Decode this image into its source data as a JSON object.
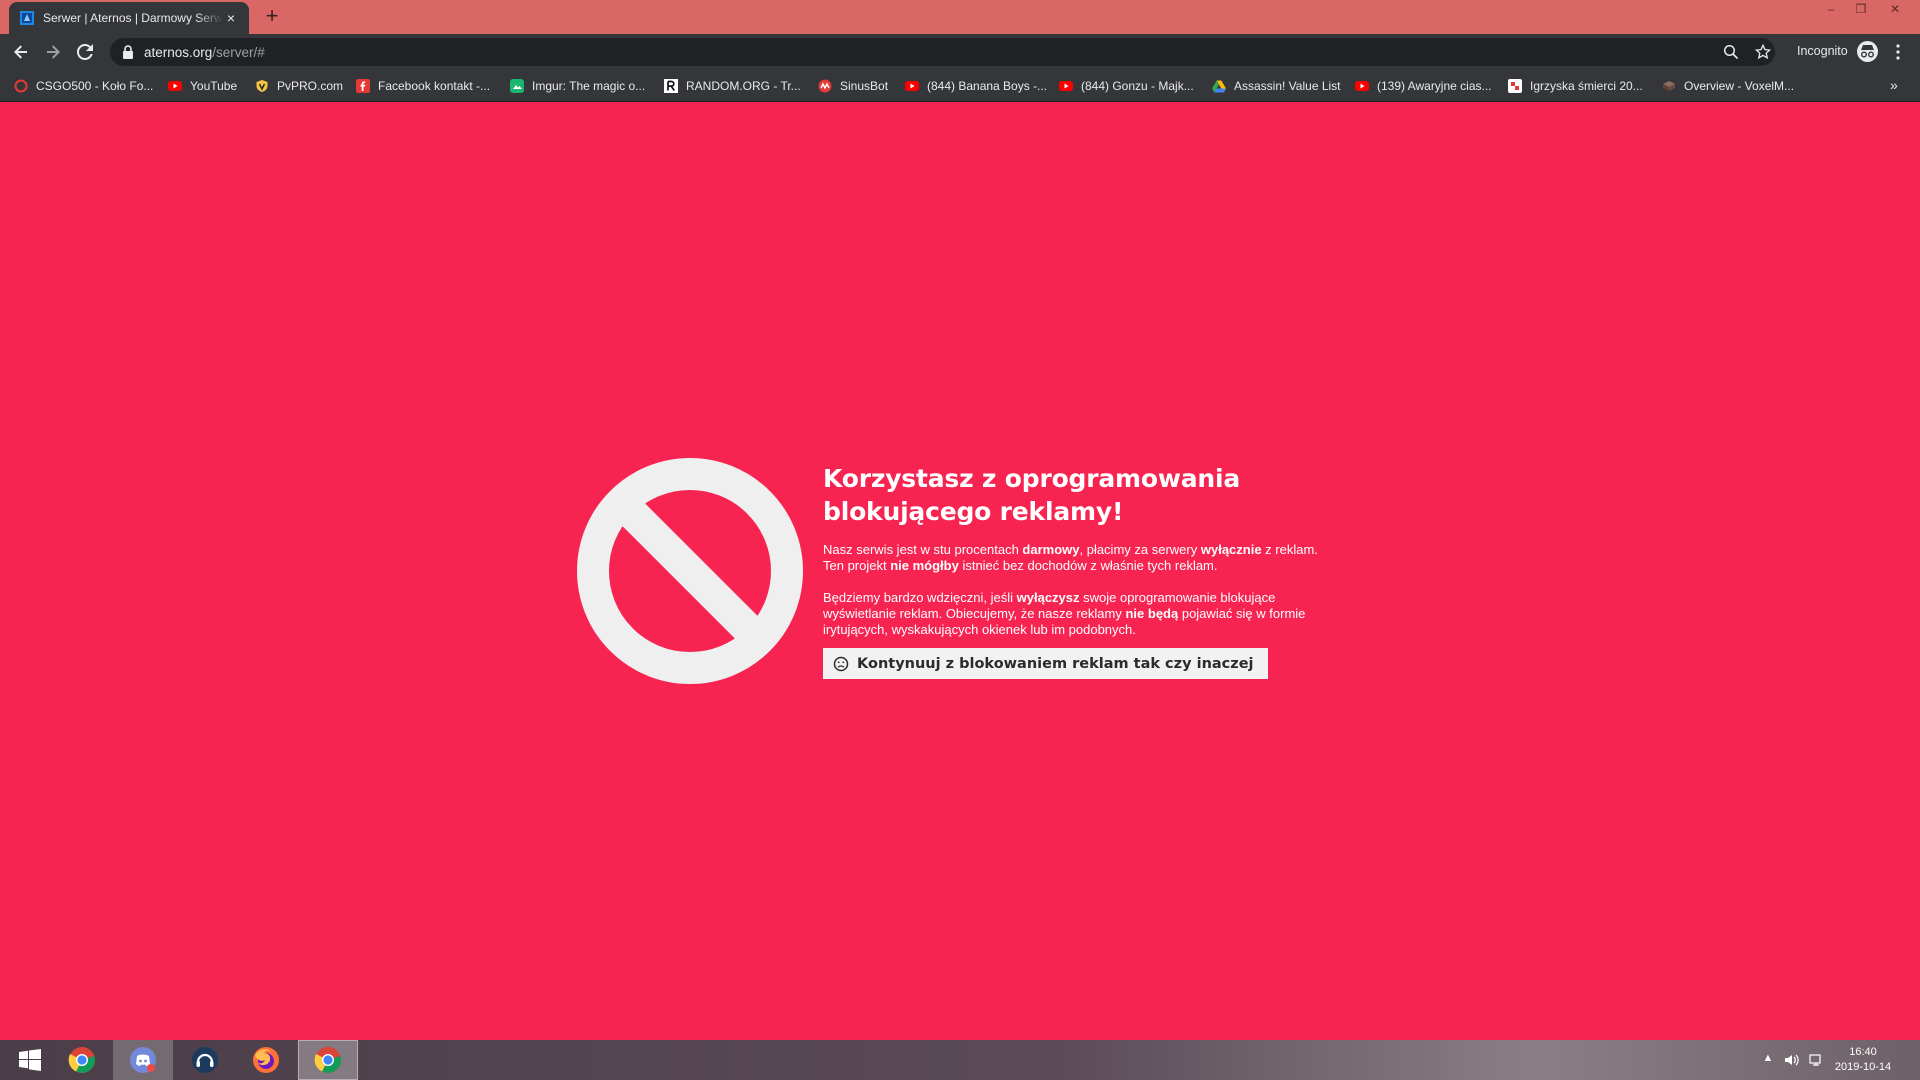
{
  "browser": {
    "tab_title": "Serwer | Aternos | Darmowy Serwer Minecraft",
    "url_host": "aternos.org",
    "url_path": "/server/#",
    "incognito_label": "Incognito",
    "new_tab_symbol": "+",
    "close_symbol": "×",
    "more_bookmarks_symbol": "»",
    "window_controls": [
      "–",
      "❐",
      "✕"
    ]
  },
  "bookmarks": [
    {
      "label": "CSGO500 - Koło Fo...",
      "icon": "csgo500-icon"
    },
    {
      "label": "YouTube",
      "icon": "youtube-icon"
    },
    {
      "label": "PvPRO.com",
      "icon": "pvpro-icon"
    },
    {
      "label": "Facebook kontakt -...",
      "icon": "facebook-icon"
    },
    {
      "label": "Imgur: The magic o...",
      "icon": "imgur-icon"
    },
    {
      "label": "RANDOM.ORG - Tr...",
      "icon": "random-org-icon"
    },
    {
      "label": "SinusBot",
      "icon": "sinusbot-icon"
    },
    {
      "label": "(844) Banana Boys -...",
      "icon": "youtube-icon"
    },
    {
      "label": "(844) Gonzu - Majk...",
      "icon": "youtube-icon"
    },
    {
      "label": "Assassin! Value List",
      "icon": "google-drive-icon"
    },
    {
      "label": "(139) Awaryjne cias...",
      "icon": "youtube-icon"
    },
    {
      "label": "Igrzyska śmierci 20...",
      "icon": "igrzyska-icon"
    },
    {
      "label": "Overview - VoxelM...",
      "icon": "voxelm-icon"
    }
  ],
  "adblock": {
    "headline_line1": "Korzystasz z oprogramowania",
    "headline_line2": "blokującego reklamy!",
    "p1_a": "Nasz serwis jest w stu procentach ",
    "p1_b": "darmowy",
    "p1_c": ", płacimy za serwery ",
    "p1_d": "wyłącznie",
    "p1_e": " z reklam. Ten projekt ",
    "p1_f": "nie mógłby",
    "p1_g": " istnieć bez dochodów z właśnie tych reklam.",
    "p2_a": "Będziemy bardzo wdzięczni, jeśli ",
    "p2_b": "wyłączysz",
    "p2_c": " swoje oprogramowanie blokujące wyświetlanie reklam. Obiecujemy, że nasze reklamy ",
    "p2_d": "nie będą",
    "p2_e": " pojawiać się w formie irytujących, wyskakujących okienek lub im podobnych.",
    "continue_label": "Kontynuuj z blokowaniem reklam tak czy inaczej"
  },
  "taskbar": {
    "apps": [
      "start-icon",
      "chrome-icon",
      "discord-icon",
      "teamspeak-icon",
      "firefox-icon",
      "chrome-icon"
    ],
    "time": "16:40",
    "date": "2019-10-14"
  },
  "colors": {
    "page_bg": "#f72451",
    "tabbar_bg": "#d96766",
    "toolbar_bg": "#35363a"
  }
}
